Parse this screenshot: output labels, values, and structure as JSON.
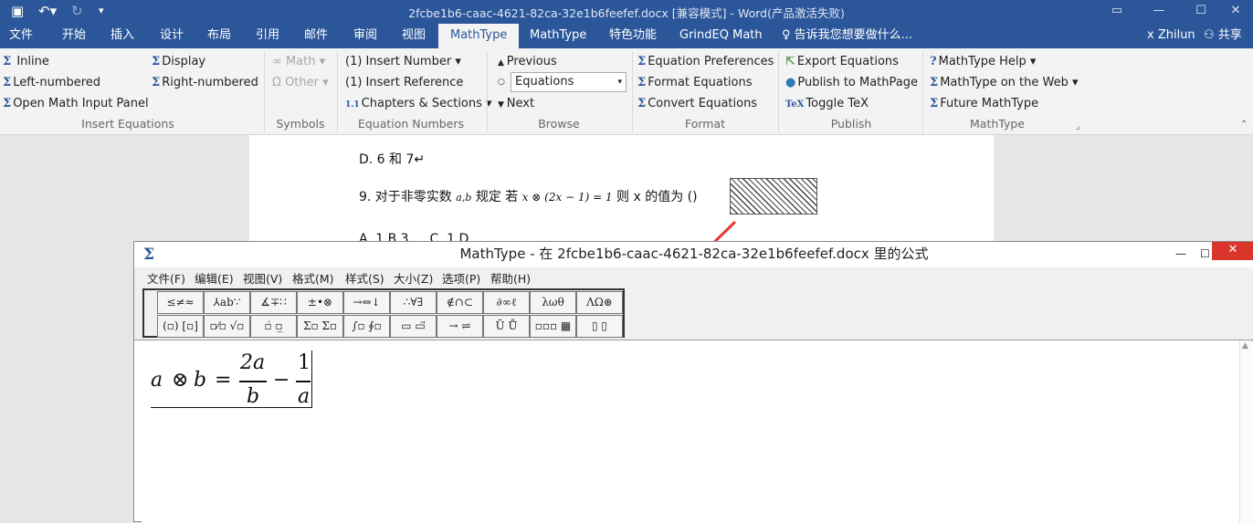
{
  "window": {
    "title": "2fcbe1b6-caac-4621-82ca-32e1b6feefef.docx [兼容模式] - Word(产品激活失败)"
  },
  "tabs": [
    "文件",
    "开始",
    "插入",
    "设计",
    "布局",
    "引用",
    "邮件",
    "审阅",
    "视图",
    "MathType",
    "MathType",
    "特色功能",
    "GrindEQ Math"
  ],
  "tell_me": "告诉我您想要做什么...",
  "user": "x Zhilun",
  "share": "共享",
  "ribbon": {
    "insert_equations": {
      "inline": "Inline",
      "left_numbered": "Left-numbered",
      "open_math_input": "Open Math Input Panel",
      "display": "Display",
      "right_numbered": "Right-numbered",
      "label": "Insert Equations"
    },
    "symbols": {
      "math": "Math",
      "other": "Other",
      "label": "Symbols"
    },
    "equation_numbers": {
      "insert_number": "(1) Insert Number",
      "insert_reference": "(1) Insert Reference",
      "chapters_sections": "Chapters & Sections",
      "label": "Equation Numbers"
    },
    "browse": {
      "previous": "Previous",
      "equations": "Equations",
      "next": "Next",
      "label": "Browse"
    },
    "format": {
      "equation_preferences": "Equation Preferences",
      "format_equations": "Format Equations",
      "convert_equations": "Convert Equations",
      "label": "Format"
    },
    "publish": {
      "export_equations": "Export Equations",
      "publish_mathpage": "Publish to MathPage",
      "toggle_tex": "Toggle TeX",
      "label": "Publish"
    },
    "mathtype": {
      "help": "MathType Help",
      "on_web": "MathType on the Web",
      "future": "Future MathType",
      "label": "MathType"
    }
  },
  "document": {
    "line1": "D. 6 和 7↵",
    "line2_prefix": "9. 对于非零实数",
    "line2_ab": "a,b",
    "line2_mid": "规定 若",
    "line2_eq": "x ⊗ (2x − 1) = 1",
    "line2_suffix": "则 x 的值为 ()",
    "line3": "A. 1 B.3 … C. 1 D."
  },
  "mathtype_window": {
    "title": "MathType - 在 2fcbe1b6-caac-4621-82ca-32e1b6feefef.docx 里的公式",
    "menu": [
      "文件(F)",
      "编辑(E)",
      "视图(V)",
      "格式(M)",
      "样式(S)",
      "大小(Z)",
      "选项(P)",
      "帮助(H)"
    ],
    "palettes": [
      "≤≠≈",
      "⅄ab∵",
      "∡∓∷",
      "±•⊗",
      "→⇔↓",
      "∴∀∃",
      "∉∩⊂",
      "∂∞ℓ",
      "λωθ",
      "ΛΩ⊛",
      "(▫) [▫]",
      "▫⁄▫ √▫",
      "▫̇ ▫̲",
      "Σ▫ Σ▫",
      "∫▫ ∮▫",
      "▭ ▭⃗",
      "→ ⇌",
      "Ū Ů",
      "▫▫▫ ▦",
      "▯ ▯"
    ],
    "formula": {
      "a": "a",
      "otimes": "⊗",
      "b": "b",
      "eq": "=",
      "num1": "2a",
      "den1": "b",
      "minus": "−",
      "num2": "1",
      "den2": "a"
    }
  }
}
